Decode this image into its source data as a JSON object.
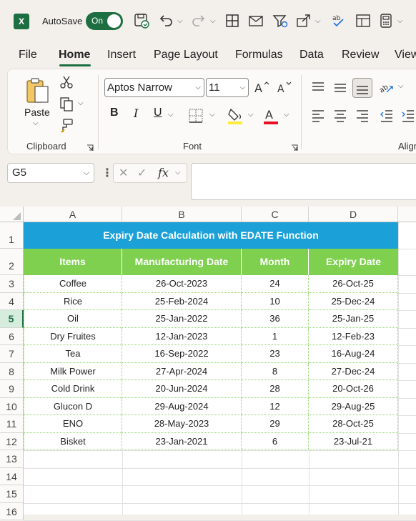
{
  "titlebar": {
    "logo": "X",
    "autosave_label": "AutoSave",
    "toggle_label": "On",
    "icons": [
      "save-icon",
      "undo-icon",
      "redo-icon",
      "table-icon",
      "mail-icon",
      "filter-icon",
      "share-icon",
      "spelling-icon",
      "form-icon",
      "calculator-icon"
    ]
  },
  "tabs": [
    {
      "label": "File"
    },
    {
      "label": "Home"
    },
    {
      "label": "Insert"
    },
    {
      "label": "Page Layout"
    },
    {
      "label": "Formulas"
    },
    {
      "label": "Data"
    },
    {
      "label": "Review"
    },
    {
      "label": "View"
    }
  ],
  "ribbon": {
    "clipboard": {
      "paste_label": "Paste",
      "group_label": "Clipboard"
    },
    "font": {
      "font_name": "Aptos Narrow",
      "font_size": "11",
      "group_label": "Font",
      "bold": "B",
      "italic": "I",
      "underline": "U",
      "grow": "A",
      "shrink": "A",
      "font_color_letter": "A",
      "fill_color": "#ffeb3b",
      "font_color": "#e81123"
    },
    "alignment": {
      "group_label": "Alignment"
    }
  },
  "formula_bar": {
    "name_box": "G5",
    "fx_label": "fx",
    "formula": ""
  },
  "sheet": {
    "columns": [
      "A",
      "B",
      "C",
      "D"
    ],
    "rows": [
      "1",
      "2",
      "3",
      "4",
      "5",
      "6",
      "7",
      "8",
      "9",
      "10",
      "11",
      "12",
      "13",
      "14",
      "15",
      "16"
    ],
    "selected_row": "5",
    "title": "Expiry Date Calculation with EDATE Function",
    "headers": [
      "Items",
      "Manufacturing Date",
      "Month",
      "Expiry Date"
    ],
    "data": [
      [
        "Coffee",
        "26-Oct-2023",
        "24",
        "26-Oct-25"
      ],
      [
        "Rice",
        "25-Feb-2024",
        "10",
        "25-Dec-24"
      ],
      [
        "Oil",
        "25-Jan-2022",
        "36",
        "25-Jan-25"
      ],
      [
        "Dry Fruites",
        "12-Jan-2023",
        "1",
        "12-Feb-23"
      ],
      [
        "Tea",
        "16-Sep-2022",
        "23",
        "16-Aug-24"
      ],
      [
        "Milk Power",
        "27-Apr-2024",
        "8",
        "27-Dec-24"
      ],
      [
        "Cold Drink",
        "20-Jun-2024",
        "28",
        "20-Oct-26"
      ],
      [
        "Glucon D",
        "29-Aug-2024",
        "12",
        "29-Aug-25"
      ],
      [
        "ENO",
        "28-May-2023",
        "29",
        "28-Oct-25"
      ],
      [
        "Bisket",
        "23-Jan-2021",
        "6",
        "23-Jul-21"
      ]
    ],
    "colors": {
      "title_fill": "#1ba1d8",
      "header_fill": "#7ed04e",
      "border": "#8fd46a",
      "selection": "#1d6f42"
    }
  }
}
